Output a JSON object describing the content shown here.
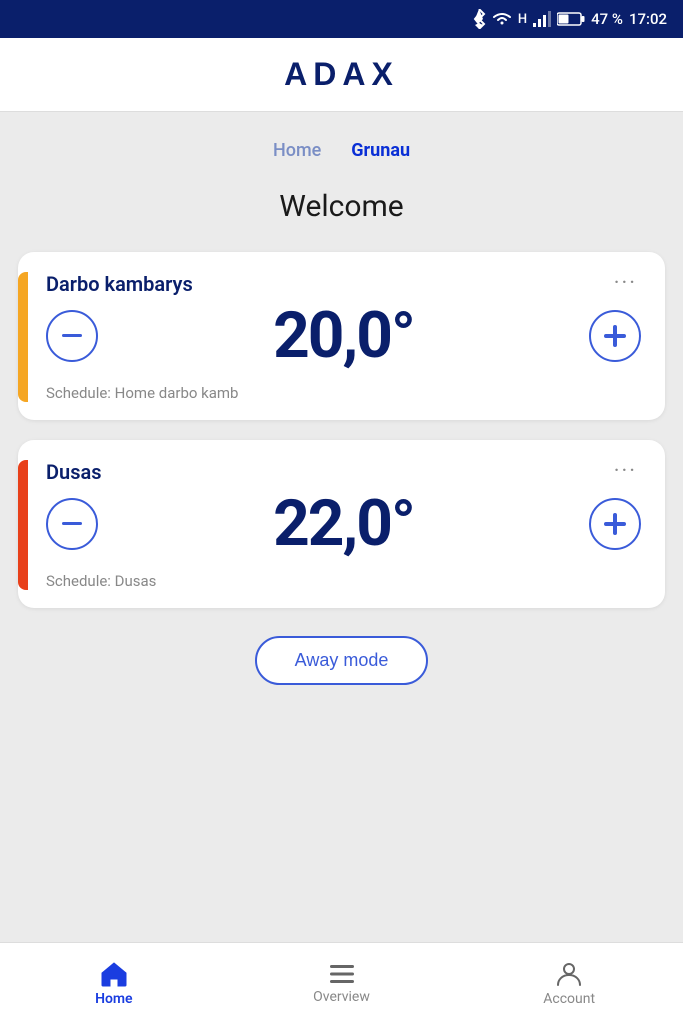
{
  "statusBar": {
    "battery": "47 %",
    "time": "17:02"
  },
  "header": {
    "logo": "ADAX"
  },
  "locationTabs": [
    {
      "label": "Home",
      "active": false
    },
    {
      "label": "Grunau",
      "active": true
    }
  ],
  "welcome": {
    "text": "Welcome"
  },
  "devices": [
    {
      "id": "darbo",
      "name": "Darbo kambarys",
      "temperature": "20,0°",
      "schedule": "Schedule: Home darbo kamb",
      "accent": "yellow"
    },
    {
      "id": "dusas",
      "name": "Dusas",
      "temperature": "22,0°",
      "schedule": "Schedule: Dusas",
      "accent": "orange-red"
    }
  ],
  "awayMode": {
    "label": "Away mode"
  },
  "nav": [
    {
      "id": "home",
      "label": "Home",
      "active": true
    },
    {
      "id": "overview",
      "label": "Overview",
      "active": false
    },
    {
      "id": "account",
      "label": "Account",
      "active": false
    }
  ]
}
